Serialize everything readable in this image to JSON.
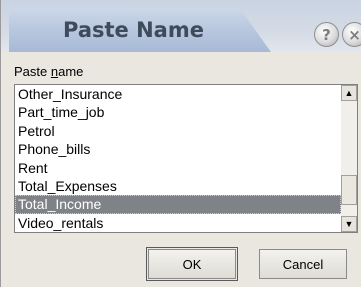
{
  "window": {
    "title": "Paste Name",
    "help_glyph": "?",
    "close_glyph": "×"
  },
  "label": {
    "prefix": "Paste ",
    "accel": "n",
    "suffix": "ame"
  },
  "list": {
    "items": [
      "Other_Insurance",
      "Part_time_job",
      "Petrol",
      "Phone_bills",
      "Rent",
      "Total_Expenses",
      "Total_Income",
      "Video_rentals"
    ],
    "selected": "Total_Income"
  },
  "scrollbar": {
    "up_glyph": "▲",
    "down_glyph": "▼"
  },
  "buttons": {
    "ok": "OK",
    "cancel": "Cancel"
  }
}
